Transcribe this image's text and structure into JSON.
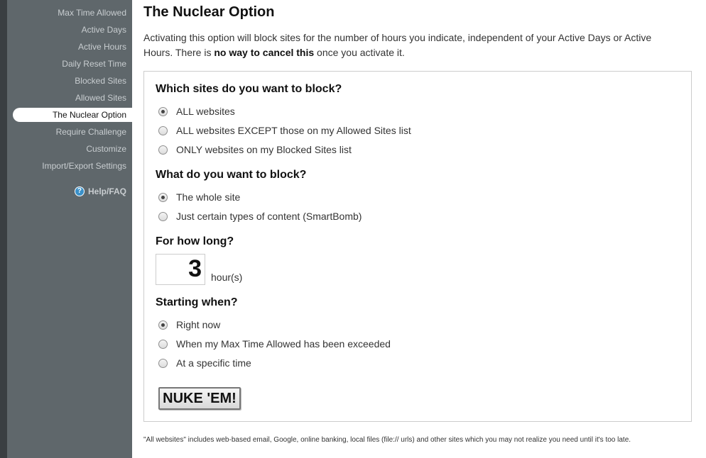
{
  "sidebar": {
    "items": [
      {
        "label": "Max Time Allowed"
      },
      {
        "label": "Active Days"
      },
      {
        "label": "Active Hours"
      },
      {
        "label": "Daily Reset Time"
      },
      {
        "label": "Blocked Sites"
      },
      {
        "label": "Allowed Sites"
      },
      {
        "label": "The Nuclear Option",
        "active": true
      },
      {
        "label": "Require Challenge"
      },
      {
        "label": "Customize"
      },
      {
        "label": "Import/Export Settings"
      }
    ],
    "help_label": "Help/FAQ",
    "help_icon": "question-circle-icon",
    "help_icon_glyph": "?"
  },
  "main": {
    "title": "The Nuclear Option",
    "intro_part1": "Activating this option will block sites for the number of hours you indicate, independent of your Active Days or Active Hours. There is ",
    "intro_bold": "no way to cancel this",
    "intro_part2": " once you activate it.",
    "questions": {
      "which_sites": {
        "label": "Which sites do you want to block?",
        "options": [
          "ALL websites",
          "ALL websites EXCEPT those on my Allowed Sites list",
          "ONLY websites on my Blocked Sites list"
        ],
        "selected": 0
      },
      "what_block": {
        "label": "What do you want to block?",
        "options": [
          "The whole site",
          "Just certain types of content (SmartBomb)"
        ],
        "selected": 0
      },
      "how_long": {
        "label": "For how long?",
        "value": "3",
        "unit": "hour(s)"
      },
      "starting": {
        "label": "Starting when?",
        "options": [
          "Right now",
          "When my Max Time Allowed has been exceeded",
          "At a specific time"
        ],
        "selected": 0
      }
    },
    "nuke_button_label": "NUKE 'EM!",
    "footnote": "\"All websites\" includes web-based email, Google, online banking, local files (file:// urls) and other sites which you may not realize you need until it's too late."
  },
  "colors": {
    "sidebar_bg": "#5f676b",
    "sidebar_edge": "#3a3f42",
    "help_icon": "#3a90c8"
  }
}
